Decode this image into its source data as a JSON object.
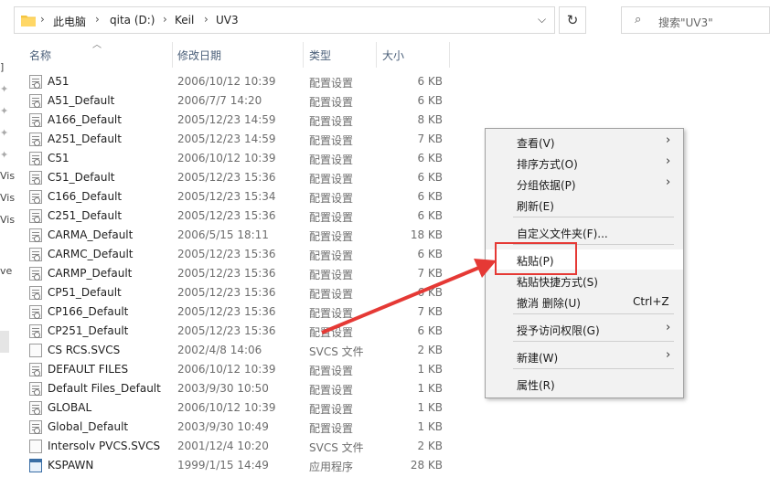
{
  "address": {
    "crumbs": [
      "此电脑",
      "qita (D:)",
      "Keil",
      "UV3"
    ],
    "separator": "›"
  },
  "search": {
    "placeholder": "搜索\"UV3\""
  },
  "columns": {
    "name": "名称",
    "date": "修改日期",
    "type": "类型",
    "size": "大小"
  },
  "nav_fragments": [
    "]",
    "Vis",
    "Vis",
    "Vis",
    "ve"
  ],
  "files": [
    {
      "name": "A51",
      "date": "2006/10/12 10:39",
      "type": "配置设置",
      "size": "6 KB",
      "icon": "config-file-icon"
    },
    {
      "name": "A51_Default",
      "date": "2006/7/7 14:20",
      "type": "配置设置",
      "size": "6 KB",
      "icon": "config-file-icon"
    },
    {
      "name": "A166_Default",
      "date": "2005/12/23 14:59",
      "type": "配置设置",
      "size": "8 KB",
      "icon": "config-file-icon"
    },
    {
      "name": "A251_Default",
      "date": "2005/12/23 14:59",
      "type": "配置设置",
      "size": "7 KB",
      "icon": "config-file-icon"
    },
    {
      "name": "C51",
      "date": "2006/10/12 10:39",
      "type": "配置设置",
      "size": "6 KB",
      "icon": "config-file-icon"
    },
    {
      "name": "C51_Default",
      "date": "2005/12/23 15:36",
      "type": "配置设置",
      "size": "6 KB",
      "icon": "config-file-icon"
    },
    {
      "name": "C166_Default",
      "date": "2005/12/23 15:34",
      "type": "配置设置",
      "size": "6 KB",
      "icon": "config-file-icon"
    },
    {
      "name": "C251_Default",
      "date": "2005/12/23 15:36",
      "type": "配置设置",
      "size": "6 KB",
      "icon": "config-file-icon"
    },
    {
      "name": "CARMA_Default",
      "date": "2006/5/15 18:11",
      "type": "配置设置",
      "size": "18 KB",
      "icon": "config-file-icon"
    },
    {
      "name": "CARMC_Default",
      "date": "2005/12/23 15:36",
      "type": "配置设置",
      "size": "6 KB",
      "icon": "config-file-icon"
    },
    {
      "name": "CARMP_Default",
      "date": "2005/12/23 15:36",
      "type": "配置设置",
      "size": "7 KB",
      "icon": "config-file-icon"
    },
    {
      "name": "CP51_Default",
      "date": "2005/12/23 15:36",
      "type": "配置设置",
      "size": "6 KB",
      "icon": "config-file-icon"
    },
    {
      "name": "CP166_Default",
      "date": "2005/12/23 15:36",
      "type": "配置设置",
      "size": "7 KB",
      "icon": "config-file-icon"
    },
    {
      "name": "CP251_Default",
      "date": "2005/12/23 15:36",
      "type": "配置设置",
      "size": "6 KB",
      "icon": "config-file-icon"
    },
    {
      "name": "CS RCS.SVCS",
      "date": "2002/4/8 14:06",
      "type": "SVCS 文件",
      "size": "2 KB",
      "icon": "file-icon"
    },
    {
      "name": "DEFAULT FILES",
      "date": "2006/10/12 10:39",
      "type": "配置设置",
      "size": "1 KB",
      "icon": "config-file-icon"
    },
    {
      "name": "Default Files_Default",
      "date": "2003/9/30 10:50",
      "type": "配置设置",
      "size": "1 KB",
      "icon": "config-file-icon"
    },
    {
      "name": "GLOBAL",
      "date": "2006/10/12 10:39",
      "type": "配置设置",
      "size": "1 KB",
      "icon": "config-file-icon"
    },
    {
      "name": "Global_Default",
      "date": "2003/9/30 10:49",
      "type": "配置设置",
      "size": "1 KB",
      "icon": "config-file-icon"
    },
    {
      "name": "Intersolv PVCS.SVCS",
      "date": "2001/12/4 10:20",
      "type": "SVCS 文件",
      "size": "2 KB",
      "icon": "file-icon"
    },
    {
      "name": "KSPAWN",
      "date": "1999/1/15 14:49",
      "type": "应用程序",
      "size": "28 KB",
      "icon": "app-icon"
    }
  ],
  "context_menu": {
    "items": [
      {
        "label": "查看(V)",
        "submenu": true
      },
      {
        "label": "排序方式(O)",
        "submenu": true
      },
      {
        "label": "分组依据(P)",
        "submenu": true
      },
      {
        "label": "刷新(E)",
        "submenu": false
      },
      {
        "label": "自定义文件夹(F)...",
        "submenu": false
      },
      {
        "label": "粘贴(P)",
        "submenu": false
      },
      {
        "label": "粘贴快捷方式(S)",
        "submenu": false
      },
      {
        "label": "撤消 删除(U)",
        "submenu": false,
        "shortcut": "Ctrl+Z"
      },
      {
        "label": "授予访问权限(G)",
        "submenu": true
      },
      {
        "label": "新建(W)",
        "submenu": true
      },
      {
        "label": "属性(R)",
        "submenu": false
      }
    ],
    "highlighted": "粘贴(P)"
  },
  "annotation": {
    "color": "#e53935"
  }
}
